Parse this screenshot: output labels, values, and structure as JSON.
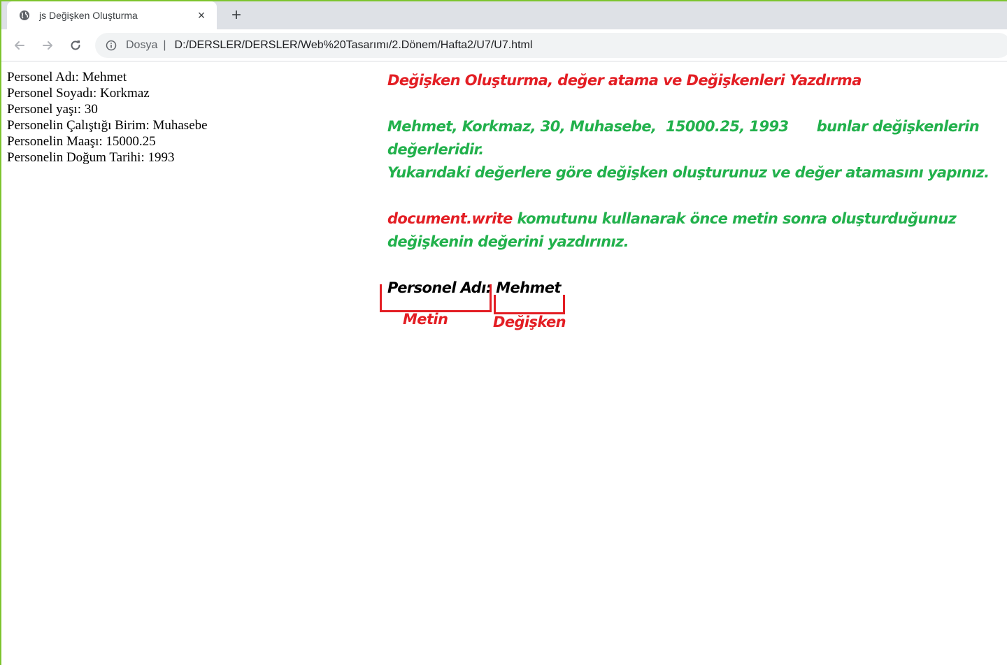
{
  "browser": {
    "tab_title": "js Değişken Oluşturma",
    "tab_close": "×",
    "new_tab": "+",
    "scheme_label": "Dosya",
    "separator": "|",
    "url": "D:/DERSLER/DERSLER/Web%20Tasarımı/2.Dönem/Hafta2/U7/U7.html"
  },
  "output_lines": [
    "Personel Adı: Mehmet",
    "Personel Soyadı: Korkmaz",
    "Personel yaşı: 30",
    "Personelin Çalıştığı Birim: Muhasebe",
    "Personelin Maaşı: 15000.25",
    "Personelin Doğum Tarihi: 1993"
  ],
  "instructions": {
    "title": "Değişken Oluşturma, değer atama ve Değişkenleri Yazdırma",
    "values_line": "Mehmet, Korkmaz, 30, Muhasebe,  15000.25, 1993      bunlar değişkenlerin değerleridir.",
    "task_line": "Yukarıdaki değerlere göre değişken oluşturunuz ve değer atamasını yapınız.",
    "command": "document.write",
    "command_rest": " komutunu kullanarak önce metin sonra oluşturduğunuz değişkenin değerini yazdırınız."
  },
  "example": {
    "text_part": "Personel Adı:",
    "variable_part": "Mehmet",
    "text_label": "Metin",
    "variable_label": "Değişken"
  },
  "colors": {
    "red": "#e31e24",
    "green": "#22b14c",
    "frame": "#7dc42e"
  }
}
